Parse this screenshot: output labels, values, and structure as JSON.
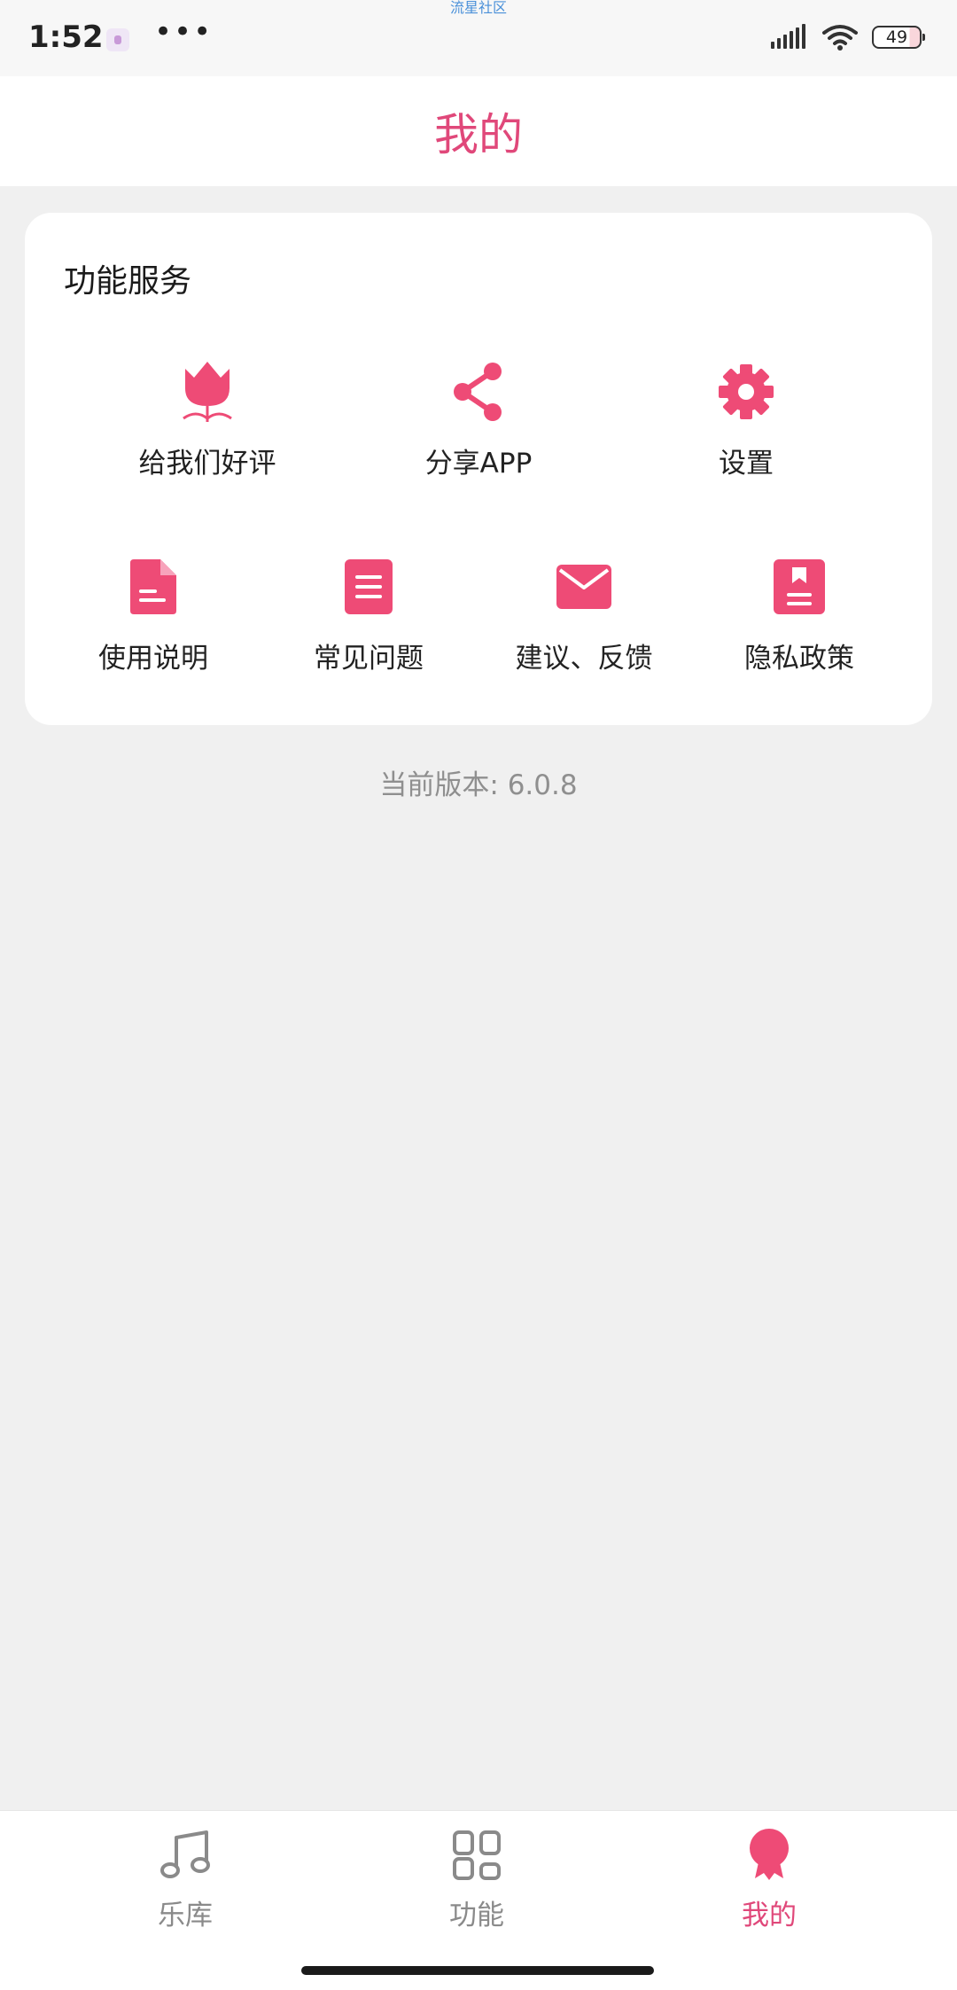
{
  "status_bar": {
    "time": "1:52",
    "more": "•••",
    "carrier_text": "流星社区",
    "battery": "49"
  },
  "header": {
    "title": "我的"
  },
  "card": {
    "title": "功能服务",
    "row1": [
      {
        "label": "给我们好评",
        "icon": "tulip-icon"
      },
      {
        "label": "分享APP",
        "icon": "share-icon"
      },
      {
        "label": "设置",
        "icon": "gear-icon"
      }
    ],
    "row2": [
      {
        "label": "使用说明",
        "icon": "document-icon"
      },
      {
        "label": "常见问题",
        "icon": "list-document-icon"
      },
      {
        "label": "建议、反馈",
        "icon": "mail-icon"
      },
      {
        "label": "隐私政策",
        "icon": "privacy-book-icon"
      }
    ]
  },
  "version": {
    "label": "当前版本:",
    "value": "6.0.8"
  },
  "tabbar": {
    "items": [
      {
        "label": "乐库",
        "icon": "music-note-icon",
        "active": false
      },
      {
        "label": "功能",
        "icon": "grid-icon",
        "active": false
      },
      {
        "label": "我的",
        "icon": "ribbon-badge-icon",
        "active": true
      }
    ]
  },
  "colors": {
    "accent": "#e0487a",
    "icon_pink": "#ee4b76",
    "background": "#f0f0f0",
    "inactive": "#8a8a8a"
  }
}
